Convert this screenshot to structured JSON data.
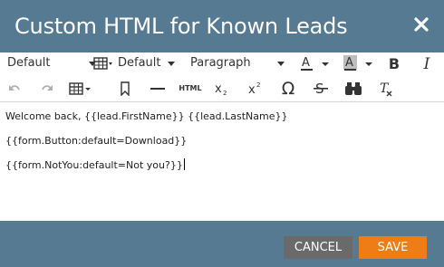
{
  "dialog": {
    "title": "Custom HTML for Known Leads",
    "close_icon": "close-icon"
  },
  "toolbar": {
    "font_family": "Default",
    "font_size": "Default",
    "block_format": "Paragraph",
    "table_icon": "table-icon",
    "text_color_icon": "text-color-icon",
    "background_color_icon": "background-color-icon",
    "bold_icon": "bold-icon",
    "italic_icon": "italic-icon",
    "undo_icon": "undo-icon",
    "redo_icon": "redo-icon",
    "insert_table_icon": "insert-table-icon",
    "bookmark_icon": "bookmark-icon",
    "horizontal_rule_icon": "horizontal-rule-icon",
    "html_label": "HTML",
    "subscript_icon": "subscript-icon",
    "superscript_icon": "superscript-icon",
    "omega_icon": "special-character-icon",
    "strikethrough_icon": "strikethrough-icon",
    "find_icon": "binoculars-icon",
    "clear_format_icon": "clear-formatting-icon"
  },
  "editor": {
    "lines": [
      "Welcome back, {{lead.FirstName}} {{lead.LastName}}",
      "{{form.Button:default=Download}}",
      "{{form.NotYou:default=Not you?}}"
    ]
  },
  "footer": {
    "cancel_label": "CANCEL",
    "save_label": "SAVE"
  },
  "colors": {
    "header": "#557a91",
    "save": "#ee7d16",
    "cancel": "#6a6a6a"
  }
}
